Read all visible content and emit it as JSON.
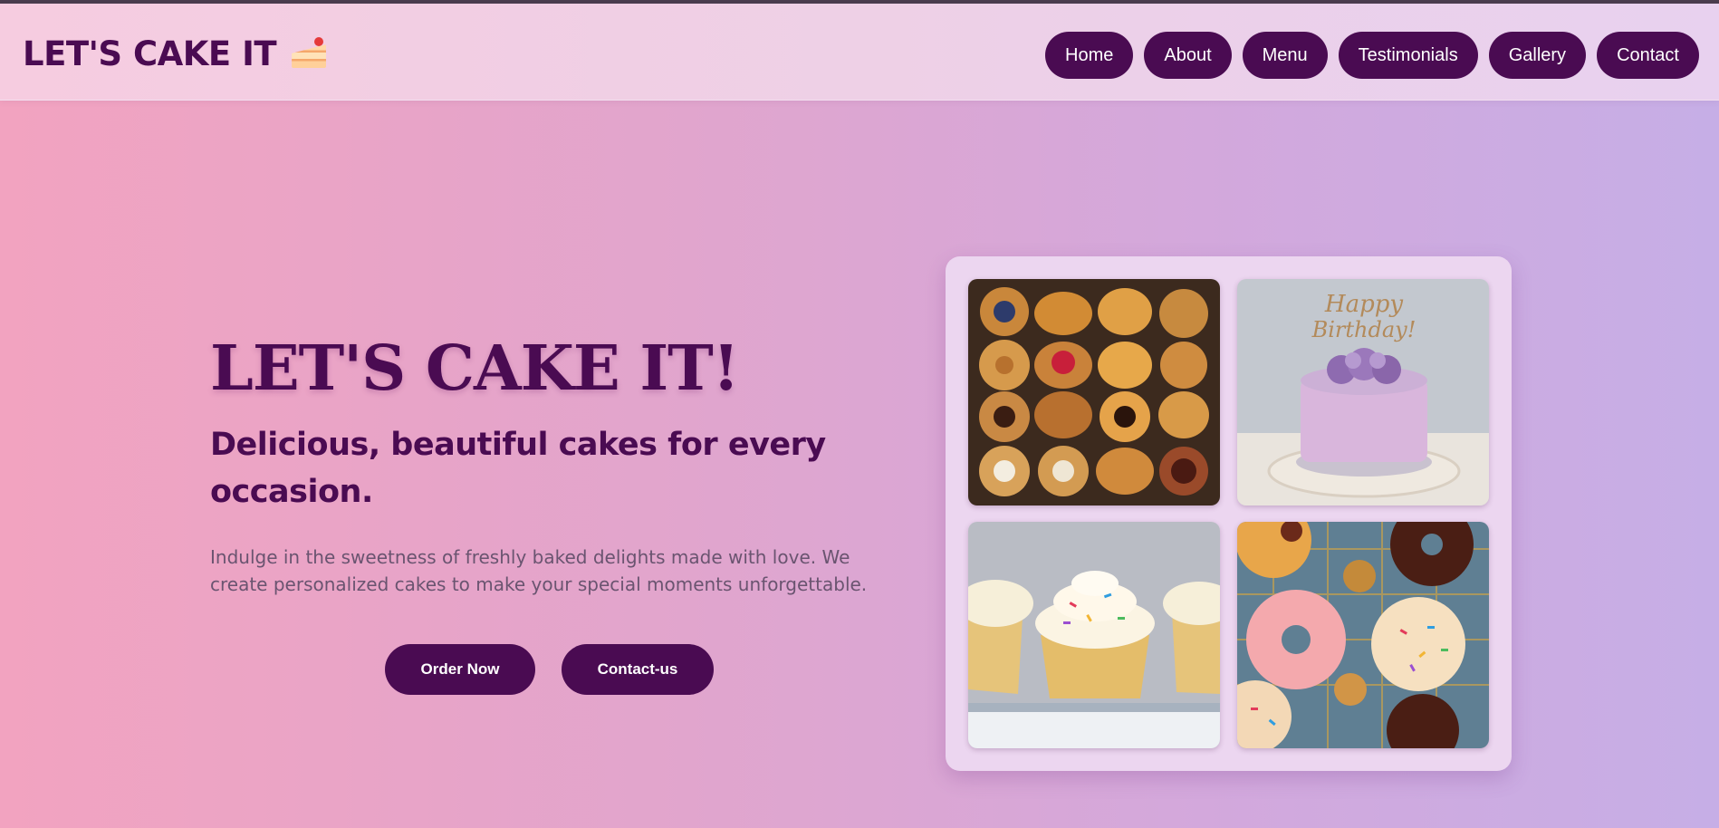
{
  "header": {
    "logo_text": "LET'S CAKE IT",
    "logo_icon": "cake-slice-icon",
    "nav": [
      {
        "label": "Home"
      },
      {
        "label": "About"
      },
      {
        "label": "Menu"
      },
      {
        "label": "Testimonials"
      },
      {
        "label": "Gallery"
      },
      {
        "label": "Contact"
      }
    ]
  },
  "hero": {
    "title": "LET'S CAKE IT!",
    "subtitle": "Delicious, beautiful cakes for every occasion.",
    "description": "Indulge in the sweetness of freshly baked delights made with love. We create personalized cakes to make your special moments unforgettable.",
    "order_label": "Order Now",
    "contact_label": "Contact-us"
  },
  "gallery": {
    "images": [
      "pastries-image",
      "birthday-cake-image",
      "cupcakes-image",
      "donuts-image"
    ],
    "cake_topper_text": "Happy Birthday!"
  },
  "colors": {
    "brand": "#4a0b52",
    "bg_start": "#f2a3c0",
    "bg_end": "#c6aee6",
    "card": "#ecd6f0"
  }
}
